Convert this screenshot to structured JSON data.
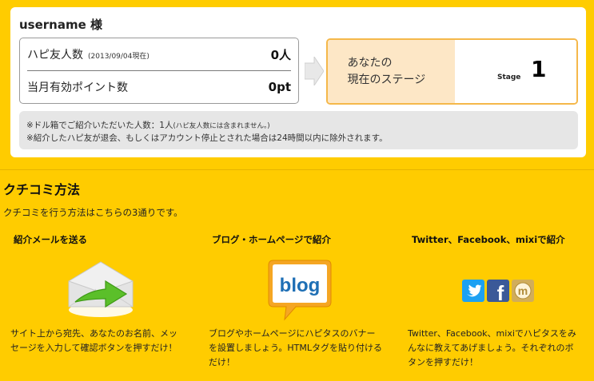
{
  "user": {
    "name": "username 様"
  },
  "stats": {
    "friends_label": "ハピ友人数",
    "friends_date": "(2013/09/04現在)",
    "friends_value": "0人",
    "points_label": "当月有効ポイント数",
    "points_value": "0pt"
  },
  "stage": {
    "label_line1": "あなたの",
    "label_line2": "現在のステージ",
    "word": "Stage",
    "value": "1"
  },
  "notes": {
    "line1_main": "※ドル箱でご紹介いただいた人数：1人",
    "line1_small": "(ハピ友人数には含まれません。)",
    "line2": "※紹介したハピ友が退会、もしくはアカウント停止とされた場合は24時間以内に除外されます。"
  },
  "section": {
    "title": "クチコミ方法",
    "desc": "クチコミを行う方法はこちらの3通りです。"
  },
  "methods": [
    {
      "title": "紹介メールを送る",
      "desc_lines": [
        "サイト上から宛先、あなたのお名前、メッ",
        "セージを入力して確認ボタンを押すだけ！"
      ]
    },
    {
      "title": "ブログ・ホームページで紹介",
      "desc_lines": [
        "ブログやホームページにハピタスのバナー",
        "を設置しましょう。HTMLタグを貼り付ける",
        "だけ！"
      ]
    },
    {
      "title": "Twitter、Facebook、mixiで紹介",
      "desc_lines": [
        "Twitter、Facebook、mixiでハピタスをみ",
        "んなに教えてあげましょう。それぞれのボ",
        "タンを押すだけ！"
      ]
    }
  ],
  "icons": {
    "blog_text": "blog",
    "facebook_letter": "f",
    "mixi_letter": "m"
  },
  "colors": {
    "background": "#ffcc00",
    "stage_bg": "#fde7c6",
    "stage_border": "#f5b84a",
    "note_bg": "#e6e6e6",
    "twitter": "#1da1f2",
    "facebook": "#3b5998",
    "mixi": "#d1ad5a"
  }
}
